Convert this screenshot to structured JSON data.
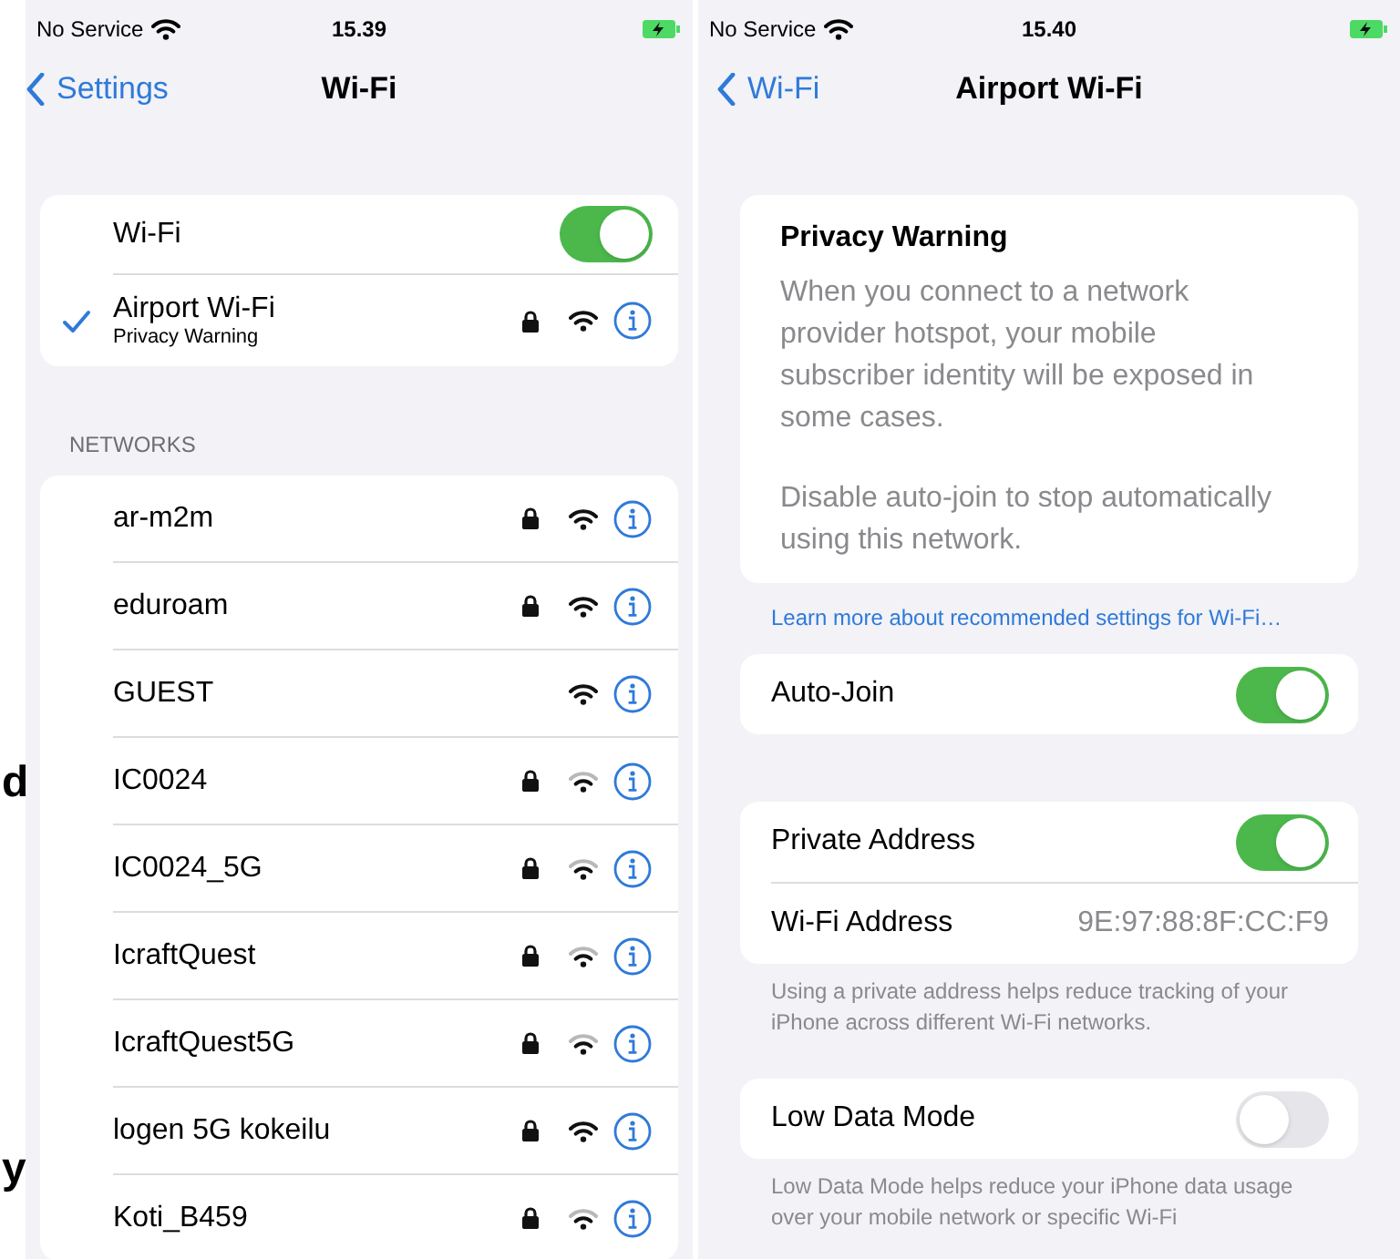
{
  "margin_fragments": [
    "d",
    "y"
  ],
  "left_screen": {
    "status_bar": {
      "carrier": "No Service",
      "time": "15.39"
    },
    "nav": {
      "back": "Settings",
      "title": "Wi-Fi"
    },
    "wifi_toggle": {
      "label": "Wi-Fi",
      "on": true
    },
    "current_network": {
      "name": "Airport Wi-Fi",
      "subtitle": "Privacy Warning",
      "selected": true,
      "secured": true,
      "weak_signal": false
    },
    "networks_header": "NETWORKS",
    "networks": [
      {
        "name": "ar-m2m",
        "secured": true,
        "weak_signal": false
      },
      {
        "name": "eduroam",
        "secured": true,
        "weak_signal": false
      },
      {
        "name": "GUEST",
        "secured": false,
        "weak_signal": false
      },
      {
        "name": "IC0024",
        "secured": true,
        "weak_signal": true
      },
      {
        "name": "IC0024_5G",
        "secured": true,
        "weak_signal": true
      },
      {
        "name": "IcraftQuest",
        "secured": true,
        "weak_signal": true
      },
      {
        "name": "IcraftQuest5G",
        "secured": true,
        "weak_signal": true
      },
      {
        "name": "logen 5G kokeilu",
        "secured": true,
        "weak_signal": false
      },
      {
        "name": "Koti_B459",
        "secured": true,
        "weak_signal": true
      }
    ]
  },
  "right_screen": {
    "status_bar": {
      "carrier": "No Service",
      "time": "15.40"
    },
    "nav": {
      "back": "Wi-Fi",
      "title": "Airport Wi-Fi"
    },
    "warning": {
      "title": "Privacy Warning",
      "paragraphs": [
        "When you connect to a network provider hotspot, your mobile subscriber identity will be exposed in some cases.",
        "Disable auto-join to stop automatically using this network."
      ]
    },
    "learn_more_link": "Learn more about recommended settings for Wi-Fi…",
    "groups": [
      {
        "rows": [
          {
            "kind": "toggle",
            "label": "Auto-Join",
            "on": true
          }
        ]
      },
      {
        "rows": [
          {
            "kind": "toggle",
            "label": "Private Address",
            "on": true
          },
          {
            "kind": "value",
            "label": "Wi-Fi Address",
            "value": "9E:97:88:8F:CC:F9"
          }
        ],
        "footer": "Using a private address helps reduce tracking of your iPhone across different Wi-Fi networks."
      },
      {
        "rows": [
          {
            "kind": "toggle",
            "label": "Low Data Mode",
            "on": false
          }
        ],
        "footer": "Low Data Mode helps reduce your iPhone data usage over your mobile network or specific Wi-Fi"
      }
    ]
  }
}
